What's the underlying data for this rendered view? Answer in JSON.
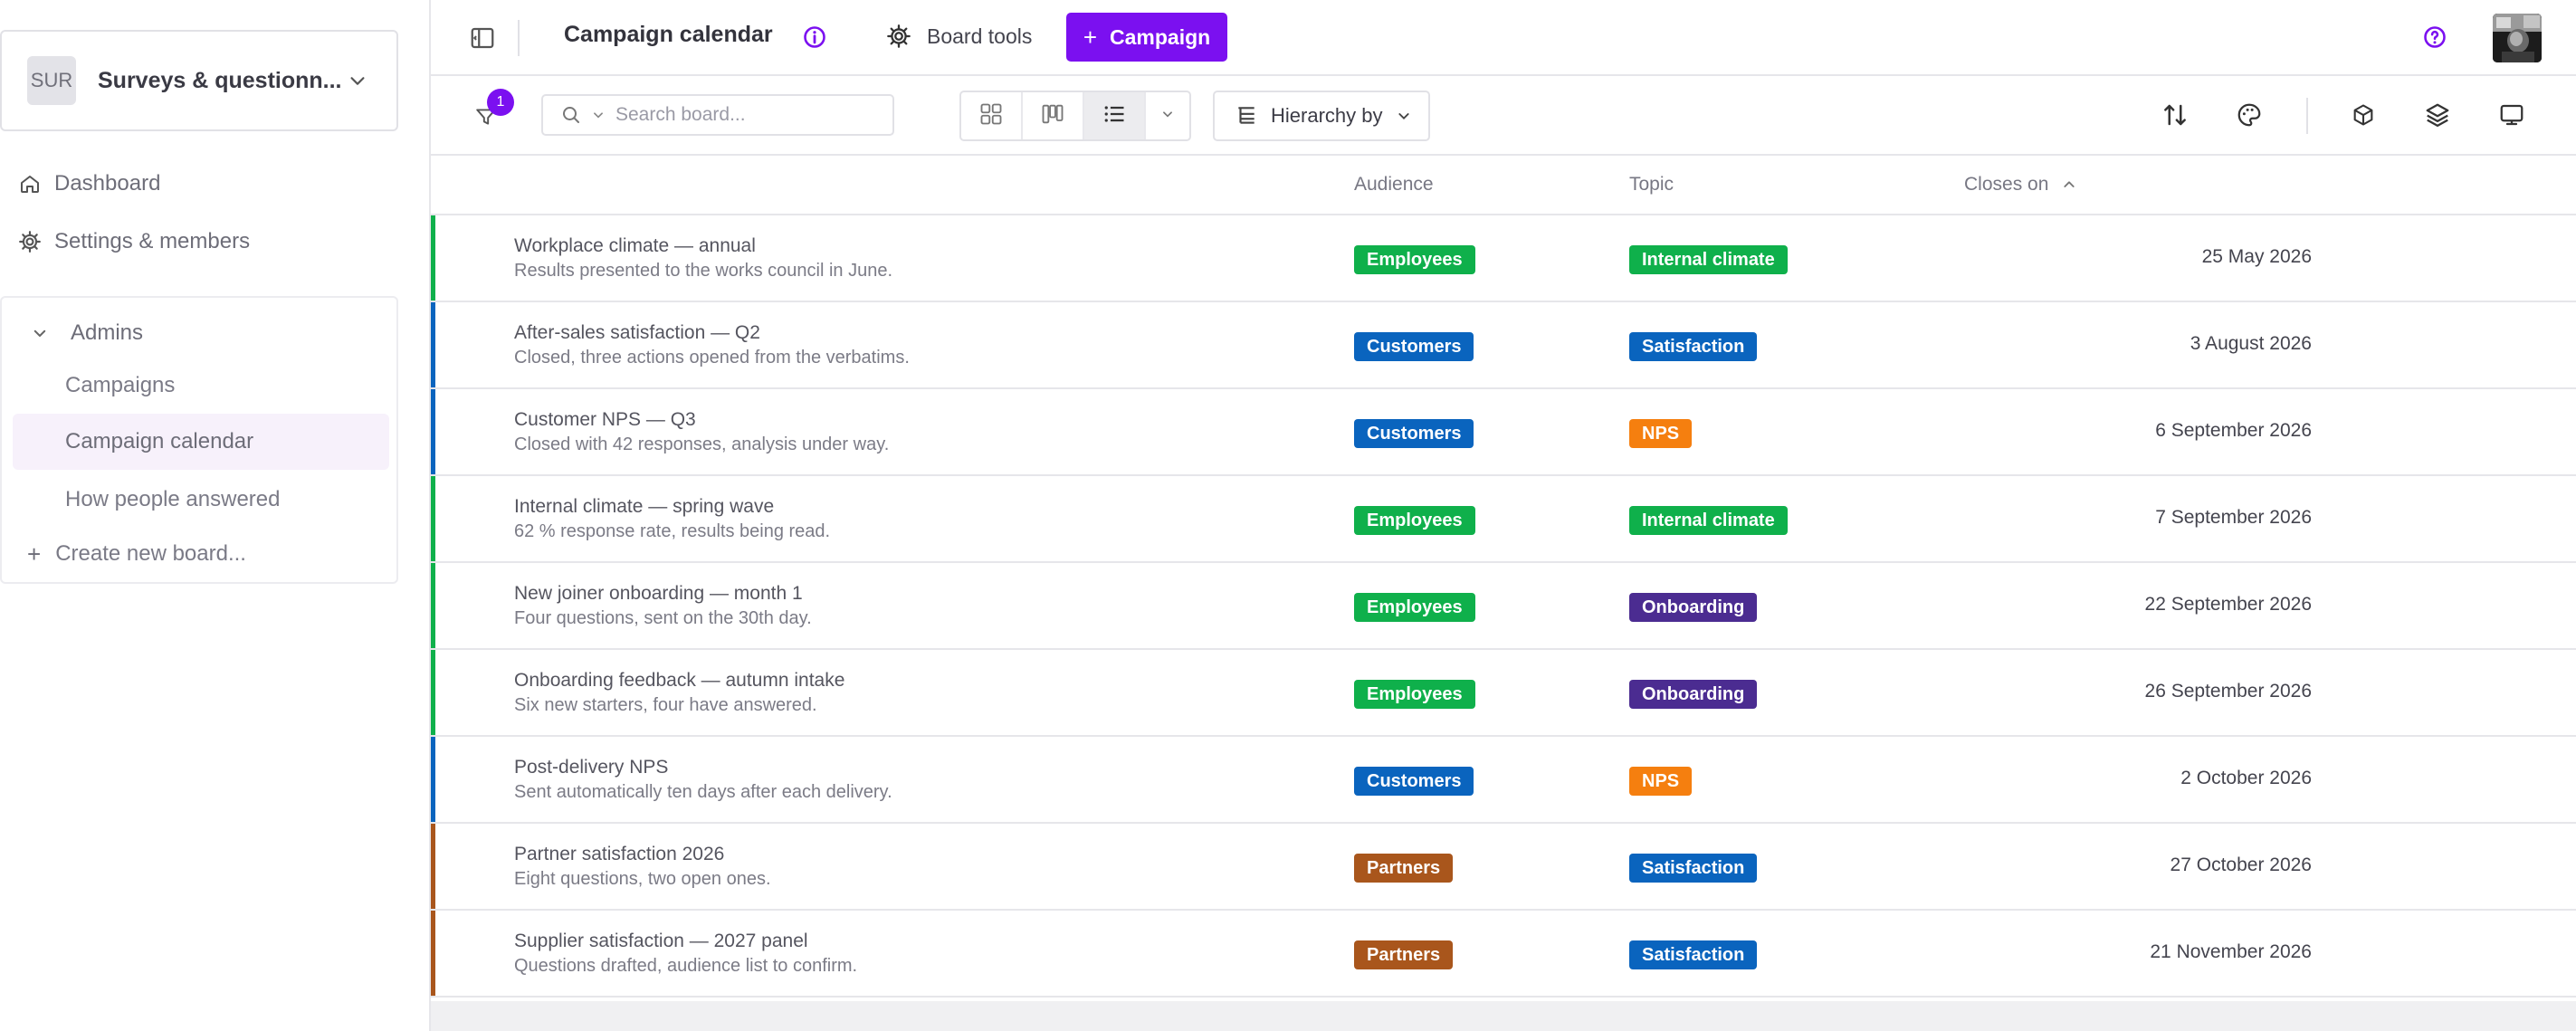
{
  "workspace": {
    "avatar_text": "SUR",
    "name": "Surveys & questionn..."
  },
  "nav": {
    "dashboard": "Dashboard",
    "settings": "Settings & members"
  },
  "group": {
    "label": "Admins",
    "boards": [
      {
        "label": "Campaigns"
      },
      {
        "label": "Campaign calendar"
      },
      {
        "label": "How people answered"
      }
    ],
    "create_label": "Create new board..."
  },
  "topbar": {
    "title": "Campaign calendar",
    "board_tools_label": "Board tools",
    "primary_button_label": "Campaign"
  },
  "toolbar": {
    "filter_count": "1",
    "search_placeholder": "Search board...",
    "hierarchy_label": "Hierarchy by"
  },
  "table": {
    "columns": {
      "audience": "Audience",
      "topic": "Topic",
      "closes_on": "Closes on"
    },
    "rows": [
      {
        "title": "Workplace climate — annual",
        "subtitle": "Results presented to the works council in June.",
        "audience": "Employees",
        "topic": "Internal climate",
        "closes_on": "25 May 2026"
      },
      {
        "title": "After-sales satisfaction — Q2",
        "subtitle": "Closed, three actions opened from the verbatims.",
        "audience": "Customers",
        "topic": "Satisfaction",
        "closes_on": "3 August 2026"
      },
      {
        "title": "Customer NPS — Q3",
        "subtitle": "Closed with 42 responses, analysis under way.",
        "audience": "Customers",
        "topic": "NPS",
        "closes_on": "6 September 2026"
      },
      {
        "title": "Internal climate — spring wave",
        "subtitle": "62 % response rate, results being read.",
        "audience": "Employees",
        "topic": "Internal climate",
        "closes_on": "7 September 2026"
      },
      {
        "title": "New joiner onboarding — month 1",
        "subtitle": "Four questions, sent on the 30th day.",
        "audience": "Employees",
        "topic": "Onboarding",
        "closes_on": "22 September 2026"
      },
      {
        "title": "Onboarding feedback — autumn intake",
        "subtitle": "Six new starters, four have answered.",
        "audience": "Employees",
        "topic": "Onboarding",
        "closes_on": "26 September 2026"
      },
      {
        "title": "Post-delivery NPS",
        "subtitle": "Sent automatically ten days after each delivery.",
        "audience": "Customers",
        "topic": "NPS",
        "closes_on": "2 October 2026"
      },
      {
        "title": "Partner satisfaction 2026",
        "subtitle": "Eight questions, two open ones.",
        "audience": "Partners",
        "topic": "Satisfaction",
        "closes_on": "27 October 2026"
      },
      {
        "title": "Supplier satisfaction — 2027 panel",
        "subtitle": "Questions drafted, audience list to confirm.",
        "audience": "Partners",
        "topic": "Satisfaction",
        "closes_on": "21 November 2026"
      }
    ]
  },
  "colors": {
    "accent": "#7b10f0",
    "active_board_bg": "#f7f1fb",
    "audience": {
      "Employees": "#0fb04b",
      "Customers": "#0a64be",
      "Partners": "#a9561c"
    },
    "topic": {
      "Internal climate": "#0fb04b",
      "Satisfaction": "#0a64be",
      "NPS": "#f57f0f",
      "Onboarding": "#4b2c91"
    }
  },
  "icons": {
    "sidebar": [
      "chevron-down-icon",
      "home-icon",
      "gear-icon",
      "chevron-down-icon",
      "plus-icon"
    ],
    "topbar": [
      "sidebar-toggle-icon",
      "info-icon",
      "gear-icon",
      "plus-icon",
      "help-icon"
    ],
    "toolbar": [
      "filter-icon",
      "search-icon",
      "chevron-down-icon",
      "grid-view-icon",
      "kanban-view-icon",
      "list-view-icon",
      "hierarchy-icon",
      "sort-icon",
      "palette-icon",
      "cube-icon",
      "layers-icon",
      "monitor-icon"
    ],
    "table": [
      "sort-ascending-icon"
    ]
  }
}
